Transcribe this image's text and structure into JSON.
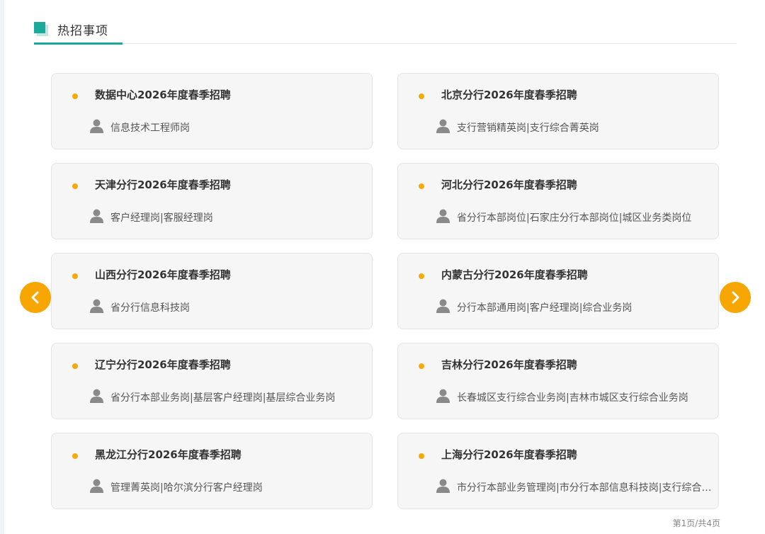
{
  "section": {
    "title": "热招事项"
  },
  "cards": [
    {
      "title": "数据中心2026年度春季招聘",
      "positions": "信息技术工程师岗"
    },
    {
      "title": "北京分行2026年度春季招聘",
      "positions": "支行营销精英岗|支行综合菁英岗"
    },
    {
      "title": "天津分行2026年度春季招聘",
      "positions": "客户经理岗|客服经理岗"
    },
    {
      "title": "河北分行2026年度春季招聘",
      "positions": "省分行本部岗位|石家庄分行本部岗位|城区业务类岗位"
    },
    {
      "title": "山西分行2026年度春季招聘",
      "positions": "省分行信息科技岗"
    },
    {
      "title": "内蒙古分行2026年度春季招聘",
      "positions": "分行本部通用岗|客户经理岗|综合业务岗"
    },
    {
      "title": "辽宁分行2026年度春季招聘",
      "positions": "省分行本部业务岗|基层客户经理岗|基层综合业务岗"
    },
    {
      "title": "吉林分行2026年度春季招聘",
      "positions": "长春城区支行综合业务岗|吉林市城区支行综合业务岗"
    },
    {
      "title": "黑龙江分行2026年度春季招聘",
      "positions": "管理菁英岗|哈尔滨分行客户经理岗"
    },
    {
      "title": "上海分行2026年度春季招聘",
      "positions": "市分行本部业务管理岗|市分行本部信息科技岗|支行综合业务岗"
    }
  ],
  "pagination": {
    "label": "第1页/共4页"
  },
  "icons": {
    "bullet": "bullet-dot-icon",
    "person": "person-icon",
    "prev": "chevron-left-icon",
    "next": "chevron-right-icon"
  },
  "colors": {
    "accent": "#1aa99a",
    "bullet": "#f6a90b",
    "arrow": "#f7a600"
  }
}
